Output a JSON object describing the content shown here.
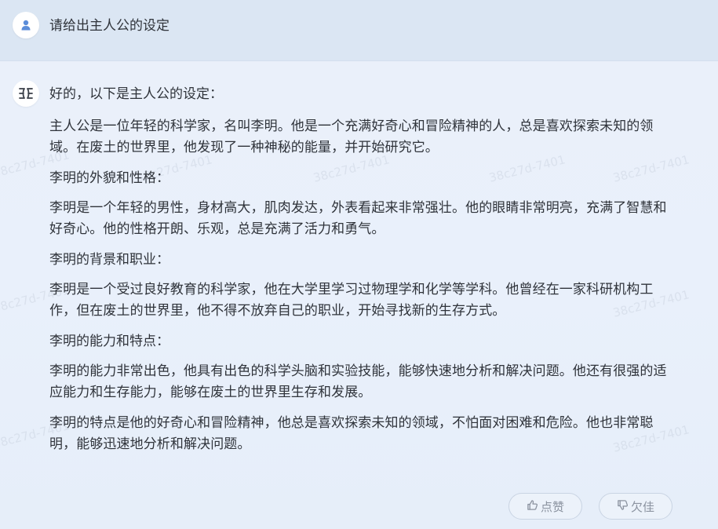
{
  "user_prompt": {
    "text": "请给出主人公的设定"
  },
  "bot_reply": {
    "intro": "好的，以下是主人公的设定：",
    "paragraphs": [
      "主人公是一位年轻的科学家，名叫李明。他是一个充满好奇心和冒险精神的人，总是喜欢探索未知的领域。在废土的世界里，他发现了一种神秘的能量，并开始研究它。",
      "李明的外貌和性格：",
      "李明是一个年轻的男性，身材高大，肌肉发达，外表看起来非常强壮。他的眼睛非常明亮，充满了智慧和好奇心。他的性格开朗、乐观，总是充满了活力和勇气。",
      "李明的背景和职业：",
      "李明是一个受过良好教育的科学家，他在大学里学习过物理学和化学等学科。他曾经在一家科研机构工作，但在废土的世界里，他不得不放弃自己的职业，开始寻找新的生存方式。",
      "李明的能力和特点：",
      "李明的能力非常出色，他具有出色的科学头脑和实验技能，能够快速地分析和解决问题。他还有很强的适应能力和生存能力，能够在废土的世界里生存和发展。",
      "李明的特点是他的好奇心和冒险精神，他总是喜欢探索未知的领域，不怕面对困难和危险。他也非常聪明，能够迅速地分析和解决问题。"
    ]
  },
  "feedback": {
    "like_label": "点赞",
    "dislike_label": "欠佳"
  },
  "watermark": {
    "text": "38c27d-7401"
  },
  "icons": {
    "user_avatar": "user-icon",
    "bot_avatar": "bot-logo-icon",
    "like": "thumbs-up-icon",
    "dislike": "thumbs-down-icon"
  },
  "colors": {
    "user_band": "#dbe6f3",
    "accent_blue": "#5b8dd9",
    "text": "#2f333a",
    "button_text": "#8b93a0"
  }
}
